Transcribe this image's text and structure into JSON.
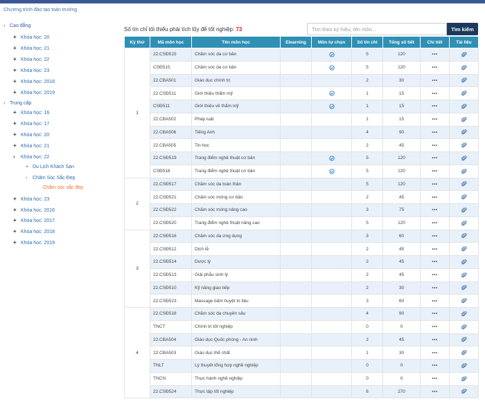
{
  "breadcrumb": "Chương trình đào tạo toàn trường",
  "tree": [
    {
      "label": "Cao đẳng",
      "level": 0,
      "toggle": "›"
    },
    {
      "label": "Khóa học: 20",
      "level": 1,
      "toggle": "+"
    },
    {
      "label": "Khóa học: 21",
      "level": 1,
      "toggle": "+"
    },
    {
      "label": "Khóa học: 22",
      "level": 1,
      "toggle": "+"
    },
    {
      "label": "Khóa học: 23",
      "level": 1,
      "toggle": "+"
    },
    {
      "label": "Khóa học: 2018",
      "level": 1,
      "toggle": "+"
    },
    {
      "label": "Khóa học: 2019",
      "level": 1,
      "toggle": "+"
    },
    {
      "label": "Trung cấp",
      "level": 0,
      "toggle": "›"
    },
    {
      "label": "Khóa học: 16",
      "level": 1,
      "toggle": "+"
    },
    {
      "label": "Khóa học: 17",
      "level": 1,
      "toggle": "+"
    },
    {
      "label": "Khóa học: 20",
      "level": 1,
      "toggle": "+"
    },
    {
      "label": "Khóa học: 21",
      "level": 1,
      "toggle": "+"
    },
    {
      "label": "Khóa học: 22",
      "level": 1,
      "toggle": "›"
    },
    {
      "label": "Du Lịch Khách Sạn",
      "level": 2,
      "toggle": "+"
    },
    {
      "label": "Chăm Sóc Sắc Đẹp",
      "level": 2,
      "toggle": "›"
    },
    {
      "label": "Chăm sóc sắc đẹp",
      "level": 3,
      "toggle": "",
      "active": true
    },
    {
      "label": "Khóa học: 23",
      "level": 1,
      "toggle": "+"
    },
    {
      "label": "Khóa học: 2016",
      "level": 1,
      "toggle": "+"
    },
    {
      "label": "Khóa học: 2017",
      "level": 1,
      "toggle": "+"
    },
    {
      "label": "Khóa học: 2018",
      "level": 1,
      "toggle": "+"
    },
    {
      "label": "Khóa học: 2019",
      "level": 1,
      "toggle": "+"
    }
  ],
  "min_credits": {
    "label": "Số tín chỉ tối thiểu phải tích lũy để tốt nghiệp:",
    "value": "73"
  },
  "search": {
    "placeholder": "Tìm theo ký hiệu, tên môn...",
    "value": "",
    "button": "Tìm kiếm"
  },
  "table": {
    "headers": [
      "Kỳ thứ",
      "Mã môn học",
      "Tên môn học",
      "Elearning",
      "Môn tự chọn",
      "Số tín chỉ",
      "Tổng số tiết",
      "Chi tiết",
      "Tài liệu"
    ],
    "detail_symbol": "•••",
    "semesters": [
      {
        "sem": "1",
        "rows": [
          {
            "code": "22.CSĐ515",
            "name": "Chăm sóc da cơ bản",
            "elective": true,
            "credits": "5",
            "hours": "120"
          },
          {
            "code": "CSĐ515",
            "name": "Chăm sóc da cơ bản",
            "elective": true,
            "credits": "5",
            "hours": "120"
          },
          {
            "code": "22.CBA501",
            "name": "Giáo dục chính trị",
            "elective": false,
            "credits": "2",
            "hours": "30"
          },
          {
            "code": "22.CSĐ511",
            "name": "Giới thiệu thẩm mỹ",
            "elective": true,
            "credits": "1",
            "hours": "15"
          },
          {
            "code": "CSĐ511",
            "name": "Giới thiệu về thẩm mỹ",
            "elective": true,
            "credits": "1",
            "hours": "15"
          },
          {
            "code": "22.CBA502",
            "name": "Pháp luật",
            "elective": false,
            "credits": "1",
            "hours": "15"
          },
          {
            "code": "22.CBA506",
            "name": "Tiếng Anh",
            "elective": false,
            "credits": "4",
            "hours": "90"
          },
          {
            "code": "22.CBA505",
            "name": "Tin học",
            "elective": false,
            "credits": "2",
            "hours": "45"
          },
          {
            "code": "22.CSĐ519",
            "name": "Trang điểm nghệ thuật cơ bản",
            "elective": true,
            "credits": "5",
            "hours": "120"
          },
          {
            "code": "CSĐ518",
            "name": "Trang điểm nghệ thuật cơ bản",
            "elective": true,
            "credits": "5",
            "hours": "120"
          }
        ]
      },
      {
        "sem": "2",
        "rows": [
          {
            "code": "22.CSĐ517",
            "name": "Chăm sóc da toàn thân",
            "elective": false,
            "credits": "5",
            "hours": "120"
          },
          {
            "code": "22.CSĐ521",
            "name": "Chăm sóc móng cơ bản",
            "elective": false,
            "credits": "2",
            "hours": "45"
          },
          {
            "code": "22.CSĐ522",
            "name": "Chăm sóc móng nâng cao",
            "elective": false,
            "credits": "3",
            "hours": "75"
          },
          {
            "code": "22.CSĐ520",
            "name": "Trang điểm nghệ thuật nâng cao",
            "elective": false,
            "credits": "5",
            "hours": "120"
          }
        ]
      },
      {
        "sem": "3",
        "rows": [
          {
            "code": "22.CSĐ516",
            "name": "Chăm sóc da ứng dụng",
            "elective": false,
            "credits": "3",
            "hours": "60"
          },
          {
            "code": "22.CSĐ512",
            "name": "Dịch tễ",
            "elective": false,
            "credits": "2",
            "hours": "45"
          },
          {
            "code": "22.CSĐ514",
            "name": "Dược lý",
            "elective": false,
            "credits": "2",
            "hours": "45"
          },
          {
            "code": "22.CSĐ513",
            "name": "Giải phẫu sinh lý",
            "elective": false,
            "credits": "2",
            "hours": "45"
          },
          {
            "code": "22.CSĐ510",
            "name": "Kỹ năng giao tiếp",
            "elective": false,
            "credits": "2",
            "hours": "30"
          },
          {
            "code": "22.CSĐ523",
            "name": "Massage bấm huyệt trị liệu",
            "elective": false,
            "credits": "3",
            "hours": "60"
          }
        ]
      },
      {
        "sem": "4",
        "rows": [
          {
            "code": "22.CSĐ518",
            "name": "Chăm sóc da chuyên sâu",
            "elective": false,
            "credits": "4",
            "hours": "90"
          },
          {
            "code": "TNCT",
            "name": "Chính trị tốt nghiệp",
            "elective": false,
            "credits": "0",
            "hours": "0"
          },
          {
            "code": "22.CBA504",
            "name": "Giáo dục Quốc phòng - An ninh",
            "elective": false,
            "credits": "2",
            "hours": "45"
          },
          {
            "code": "22.CBA503",
            "name": "Giáo dục thể chất",
            "elective": false,
            "credits": "1",
            "hours": "30"
          },
          {
            "code": "TNLT",
            "name": "Lý thuyết tổng hợp nghề nghiệp",
            "elective": false,
            "credits": "0",
            "hours": "0"
          },
          {
            "code": "TNCN",
            "name": "Thực hành nghề nghiệp",
            "elective": false,
            "credits": "0",
            "hours": "0"
          },
          {
            "code": "22.CSĐ524",
            "name": "Thực tập tốt nghiệp",
            "elective": false,
            "credits": "6",
            "hours": "270"
          }
        ]
      }
    ]
  }
}
